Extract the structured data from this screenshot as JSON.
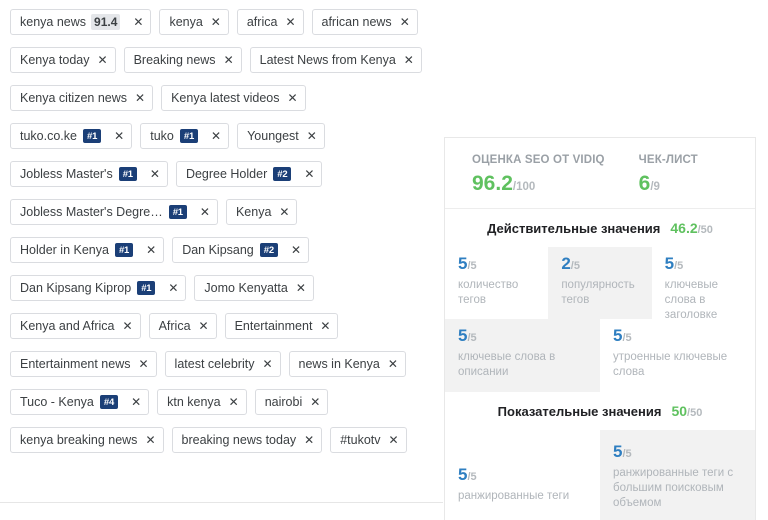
{
  "tags_panel": {
    "rows": [
      [
        {
          "label": "kenya news",
          "score": "91.4",
          "close": "✕"
        },
        {
          "label": "kenya",
          "close": "✕"
        },
        {
          "label": "africa",
          "close": "✕"
        },
        {
          "label": "african news",
          "close": "✕"
        }
      ],
      [
        {
          "label": "Kenya today",
          "close": "✕"
        },
        {
          "label": "Breaking news",
          "close": "✕"
        },
        {
          "label": "Latest News from Kenya",
          "close": "✕"
        }
      ],
      [
        {
          "label": "Kenya citizen news",
          "close": "✕"
        },
        {
          "label": "Kenya latest videos",
          "close": "✕"
        }
      ],
      [
        {
          "label": "tuko.co.ke",
          "rank": "#1",
          "close": "✕"
        },
        {
          "label": "tuko",
          "rank": "#1",
          "close": "✕"
        },
        {
          "label": "Youngest",
          "close": "✕"
        }
      ],
      [
        {
          "label": "Jobless Master's",
          "rank": "#1",
          "close": "✕"
        },
        {
          "label": "Degree Holder",
          "rank": "#2",
          "close": "✕"
        }
      ],
      [
        {
          "label": "Jobless Master's Degre…",
          "rank": "#1",
          "close": "✕"
        },
        {
          "label": "Kenya",
          "close": "✕"
        }
      ],
      [
        {
          "label": "Holder in Kenya",
          "rank": "#1",
          "close": "✕"
        },
        {
          "label": "Dan Kipsang",
          "rank": "#2",
          "close": "✕"
        }
      ],
      [
        {
          "label": "Dan Kipsang Kiprop",
          "rank": "#1",
          "close": "✕"
        },
        {
          "label": "Jomo Kenyatta",
          "close": "✕"
        }
      ],
      [
        {
          "label": "Kenya and Africa",
          "close": "✕"
        },
        {
          "label": "Africa",
          "close": "✕"
        },
        {
          "label": "Entertainment",
          "close": "✕"
        }
      ],
      [
        {
          "label": "Entertainment news",
          "close": "✕"
        },
        {
          "label": "latest celebrity",
          "close": "✕"
        },
        {
          "label": "news in Kenya",
          "close": "✕"
        }
      ],
      [
        {
          "label": "Tuco - Kenya",
          "rank": "#4",
          "close": "✕"
        },
        {
          "label": "ktn kenya",
          "close": "✕"
        },
        {
          "label": "nairobi",
          "close": "✕"
        }
      ],
      [
        {
          "label": "kenya breaking news",
          "close": "✕"
        },
        {
          "label": "breaking news today",
          "close": "✕"
        },
        {
          "label": "#tukotv",
          "close": "✕"
        }
      ]
    ]
  },
  "seo_panel": {
    "header": {
      "seo_score_caption": "ОЦЕНКА SEO ОТ VIDIQ",
      "seo_score_value": "96.2",
      "seo_score_max": "/100",
      "checklist_caption": "ЧЕК-ЛИСТ",
      "checklist_value": "6",
      "checklist_max": "/9"
    },
    "sections": [
      {
        "title": "Действительные значения",
        "value": "46.2",
        "max": "/50"
      },
      {
        "title": "Показательные значения",
        "value": "50",
        "max": "/50"
      }
    ],
    "metrics_row_a": [
      {
        "value": "5",
        "max": "/5",
        "label": "количество тегов",
        "highlighted": false
      },
      {
        "value": "2",
        "max": "/5",
        "label": "популярность тегов",
        "highlighted": true
      },
      {
        "value": "5",
        "max": "/5",
        "label": "ключевые слова в заголовке",
        "highlighted": false
      }
    ],
    "metrics_row_b": [
      {
        "value": "5",
        "max": "/5",
        "label": "ключевые слова в описании",
        "highlighted": true
      },
      {
        "value": "5",
        "max": "/5",
        "label": "утроенные ключевые слова",
        "highlighted": false
      }
    ],
    "metrics_row_c": [
      {
        "value": "5",
        "max": "/5",
        "label": "ранжированные теги",
        "highlighted": false
      },
      {
        "value": "5",
        "max": "/5",
        "label": "ранжированные теги с большим поисковым объемом",
        "highlighted": true
      }
    ]
  },
  "colors": {
    "green": "#5fc15f",
    "blue": "#2f7fc1",
    "rank_badge": "#1b3f77",
    "muted": "#b0b5ba",
    "highlight_bg": "#f2f2f2"
  }
}
